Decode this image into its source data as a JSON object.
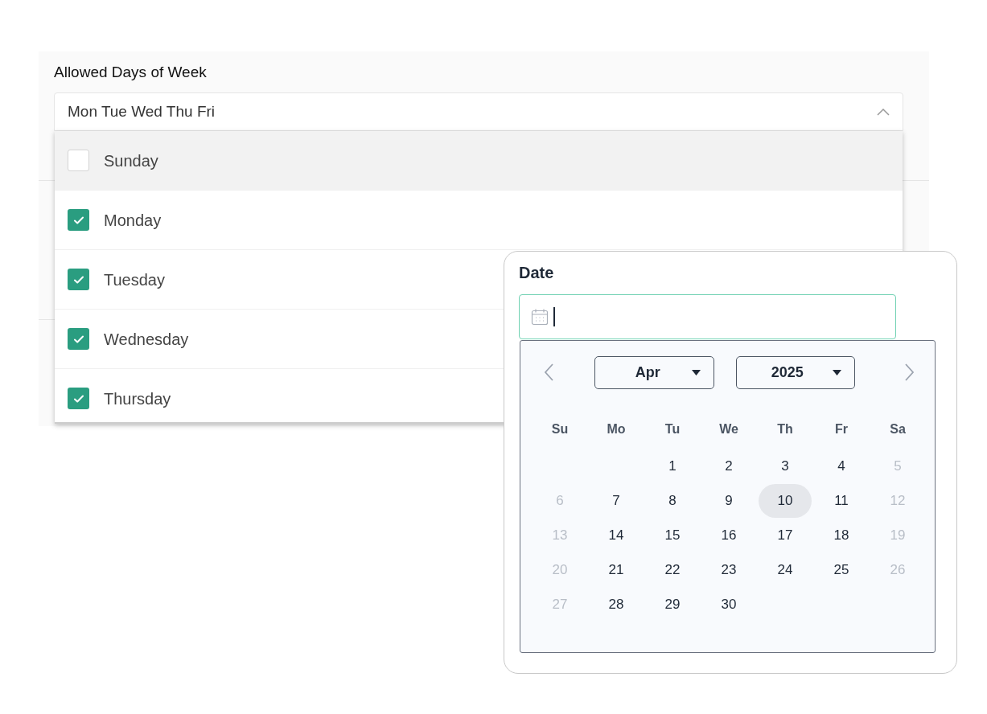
{
  "form": {
    "label": "Allowed Days of Week",
    "value": "Mon Tue Wed Thu Fri",
    "expanded": true,
    "options": [
      {
        "label": "Sunday",
        "checked": false,
        "selected": true
      },
      {
        "label": "Monday",
        "checked": true,
        "selected": false
      },
      {
        "label": "Tuesday",
        "checked": true,
        "selected": false
      },
      {
        "label": "Wednesday",
        "checked": true,
        "selected": false
      },
      {
        "label": "Thursday",
        "checked": true,
        "selected": false
      }
    ]
  },
  "date_picker": {
    "label": "Date",
    "month": "Apr",
    "year": "2025",
    "weekdays": [
      "Su",
      "Mo",
      "Tu",
      "We",
      "Th",
      "Fr",
      "Sa"
    ],
    "weeks": [
      [
        {
          "kind": "blank"
        },
        {
          "kind": "blank"
        },
        {
          "kind": "day",
          "day": "1",
          "disabled": false,
          "selected": false
        },
        {
          "kind": "day",
          "day": "2",
          "disabled": false,
          "selected": false
        },
        {
          "kind": "day",
          "day": "3",
          "disabled": false,
          "selected": false
        },
        {
          "kind": "day",
          "day": "4",
          "disabled": false,
          "selected": false
        },
        {
          "kind": "day",
          "day": "5",
          "disabled": true,
          "selected": false
        }
      ],
      [
        {
          "kind": "day",
          "day": "6",
          "disabled": true,
          "selected": false
        },
        {
          "kind": "day",
          "day": "7",
          "disabled": false,
          "selected": false
        },
        {
          "kind": "day",
          "day": "8",
          "disabled": false,
          "selected": false
        },
        {
          "kind": "day",
          "day": "9",
          "disabled": false,
          "selected": false
        },
        {
          "kind": "day",
          "day": "10",
          "disabled": false,
          "selected": true
        },
        {
          "kind": "day",
          "day": "11",
          "disabled": false,
          "selected": false
        },
        {
          "kind": "day",
          "day": "12",
          "disabled": true,
          "selected": false
        }
      ],
      [
        {
          "kind": "day",
          "day": "13",
          "disabled": true,
          "selected": false
        },
        {
          "kind": "day",
          "day": "14",
          "disabled": false,
          "selected": false
        },
        {
          "kind": "day",
          "day": "15",
          "disabled": false,
          "selected": false
        },
        {
          "kind": "day",
          "day": "16",
          "disabled": false,
          "selected": false
        },
        {
          "kind": "day",
          "day": "17",
          "disabled": false,
          "selected": false
        },
        {
          "kind": "day",
          "day": "18",
          "disabled": false,
          "selected": false
        },
        {
          "kind": "day",
          "day": "19",
          "disabled": true,
          "selected": false
        }
      ],
      [
        {
          "kind": "day",
          "day": "20",
          "disabled": true,
          "selected": false
        },
        {
          "kind": "day",
          "day": "21",
          "disabled": false,
          "selected": false
        },
        {
          "kind": "day",
          "day": "22",
          "disabled": false,
          "selected": false
        },
        {
          "kind": "day",
          "day": "23",
          "disabled": false,
          "selected": false
        },
        {
          "kind": "day",
          "day": "24",
          "disabled": false,
          "selected": false
        },
        {
          "kind": "day",
          "day": "25",
          "disabled": false,
          "selected": false
        },
        {
          "kind": "day",
          "day": "26",
          "disabled": true,
          "selected": false
        }
      ],
      [
        {
          "kind": "day",
          "day": "27",
          "disabled": true,
          "selected": false
        },
        {
          "kind": "day",
          "day": "28",
          "disabled": false,
          "selected": false
        },
        {
          "kind": "day",
          "day": "29",
          "disabled": false,
          "selected": false
        },
        {
          "kind": "day",
          "day": "30",
          "disabled": false,
          "selected": false
        },
        {
          "kind": "blank"
        },
        {
          "kind": "blank"
        },
        {
          "kind": "blank"
        }
      ]
    ]
  }
}
